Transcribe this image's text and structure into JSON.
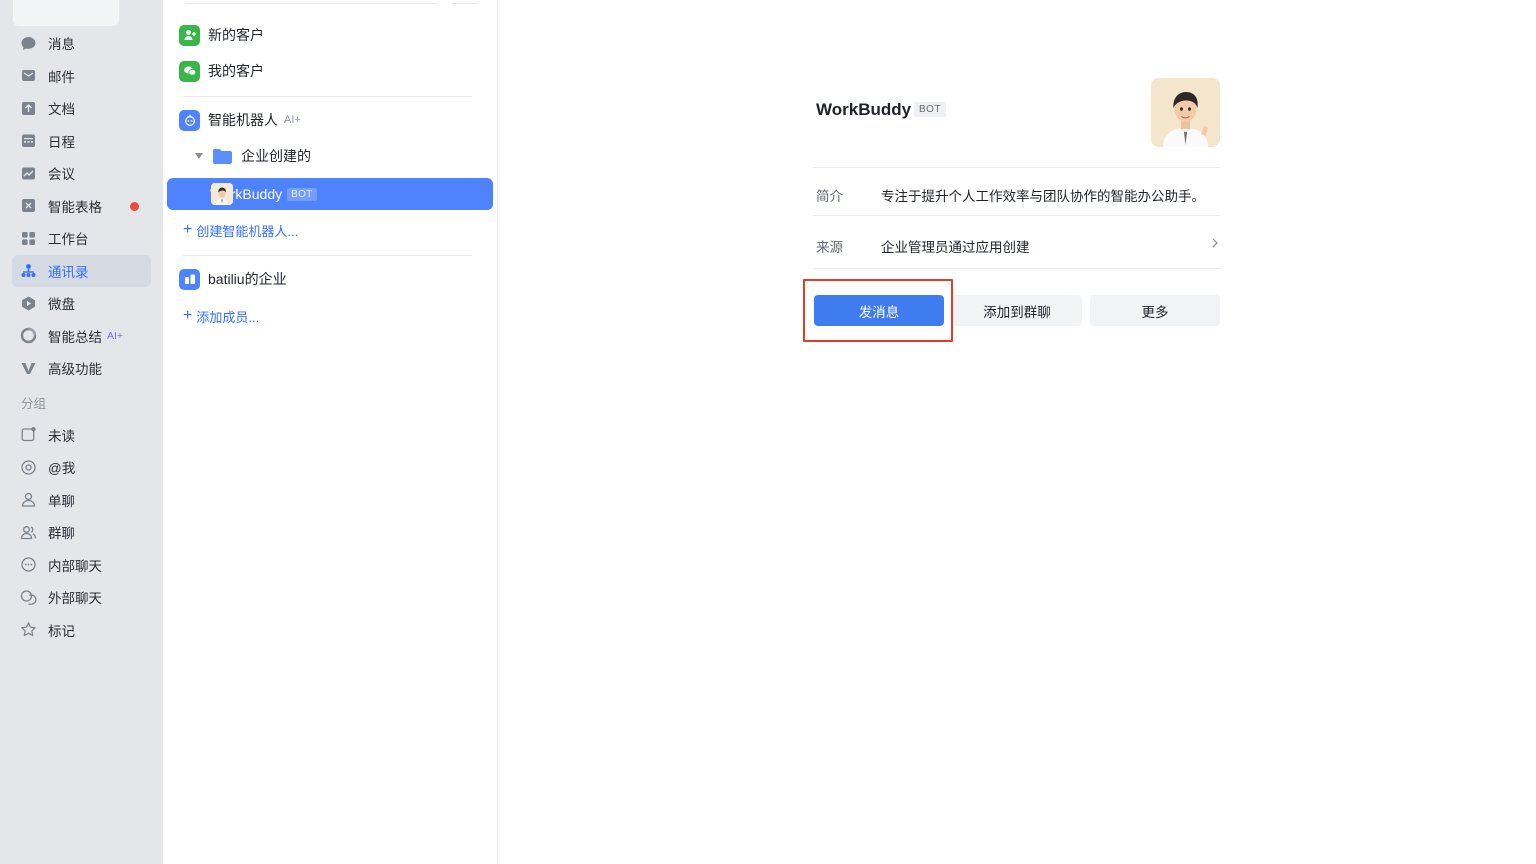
{
  "sidebar": {
    "items": [
      {
        "label": "消息",
        "icon": "message-icon"
      },
      {
        "label": "邮件",
        "icon": "mail-icon"
      },
      {
        "label": "文档",
        "icon": "docs-icon"
      },
      {
        "label": "日程",
        "icon": "calendar-icon"
      },
      {
        "label": "会议",
        "icon": "meeting-icon"
      },
      {
        "label": "智能表格",
        "icon": "smart-sheet-icon",
        "badge": "red-dot"
      },
      {
        "label": "工作台",
        "icon": "workbench-icon"
      },
      {
        "label": "通讯录",
        "icon": "contacts-icon",
        "active": true
      },
      {
        "label": "微盘",
        "icon": "drive-icon"
      },
      {
        "label": "智能总结",
        "icon": "smart-summary-icon",
        "tag": "AI+"
      },
      {
        "label": "高级功能",
        "icon": "advanced-icon"
      }
    ],
    "group_title": "分组",
    "groups": [
      {
        "label": "未读",
        "icon": "unread-icon"
      },
      {
        "label": "@我",
        "icon": "at-icon"
      },
      {
        "label": "单聊",
        "icon": "single-chat-icon"
      },
      {
        "label": "群聊",
        "icon": "group-chat-icon"
      },
      {
        "label": "内部聊天",
        "icon": "internal-chat-icon"
      },
      {
        "label": "外部聊天",
        "icon": "external-chat-icon"
      },
      {
        "label": "标记",
        "icon": "star-icon"
      }
    ]
  },
  "contacts": {
    "new_customers": "新的客户",
    "my_customers": "我的客户",
    "robots": "智能机器人",
    "robots_tag": "AI+",
    "folder": "企业创建的",
    "selected_bot": "WorkBuddy",
    "selected_bot_badge": "BOT",
    "create_robot": "创建智能机器人...",
    "org": "batiliu的企业",
    "add_member": "添加成员..."
  },
  "profile": {
    "name": "WorkBuddy",
    "badge": "BOT",
    "intro_label": "简介",
    "intro_value": "专注于提升个人工作效率与团队协作的智能办公助手。",
    "source_label": "来源",
    "source_value": "企业管理员通过应用创建",
    "buttons": {
      "send": "发消息",
      "add_group": "添加到群聊",
      "more": "更多"
    }
  },
  "colors": {
    "accent": "#3370ff",
    "selected_row": "#4e83fd",
    "primary_button": "#3f7cf0",
    "highlight_box": "#e23d2c",
    "sidebar_bg": "#e4e6ea"
  }
}
